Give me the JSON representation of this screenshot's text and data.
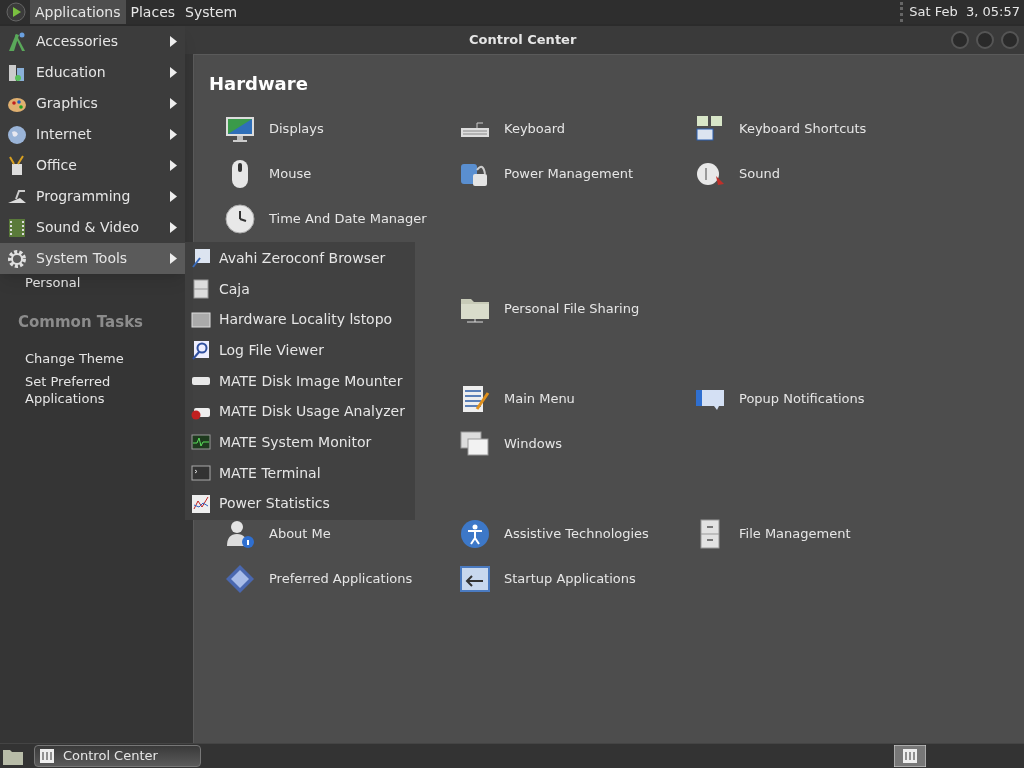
{
  "top_panel": {
    "menus": [
      {
        "label": "Applications",
        "selected": true
      },
      {
        "label": "Places",
        "selected": false
      },
      {
        "label": "System",
        "selected": false
      }
    ],
    "clock": "Sat Feb  3, 05:57"
  },
  "window": {
    "title": "Control Center",
    "sidebar": {
      "sections": [
        {
          "items": [
            "Personal"
          ]
        },
        {
          "heading": "Common Tasks",
          "items": [
            "Change Theme",
            "Set Preferred Applications"
          ]
        }
      ]
    },
    "sections": [
      {
        "heading": "Hardware",
        "rows": [
          {
            "column_1": "Displays",
            "column_2": "Keyboard",
            "column_3": "Keyboard Shortcuts"
          },
          {
            "column_1": "Mouse",
            "column_2": "Power Management",
            "column_3": "Sound"
          },
          {
            "column_1": "Time And Date Manager"
          }
        ]
      },
      {
        "rows": [
          {
            "column_2": "Personal File Sharing"
          }
        ]
      },
      {
        "rows": [
          {
            "column_2": "Main Menu",
            "column_3": "Popup Notifications"
          },
          {
            "column_2": "Windows"
          }
        ]
      },
      {
        "rows": [
          {
            "column_1": "About Me",
            "column_2": "Assistive Technologies",
            "column_3": "File Management"
          },
          {
            "column_1": "Preferred Applications",
            "column_2": "Startup Applications"
          }
        ]
      }
    ]
  },
  "applications_menu": {
    "items": [
      {
        "label": "Accessories",
        "selected": false
      },
      {
        "label": "Education",
        "selected": false
      },
      {
        "label": "Graphics",
        "selected": false
      },
      {
        "label": "Internet",
        "selected": false
      },
      {
        "label": "Office",
        "selected": false
      },
      {
        "label": "Programming",
        "selected": false
      },
      {
        "label": "Sound & Video",
        "selected": false
      },
      {
        "label": "System Tools",
        "selected": true
      }
    ],
    "submenu": [
      "Avahi Zeroconf Browser",
      "Caja",
      "Hardware Locality lstopo",
      "Log File Viewer",
      "MATE Disk Image Mounter",
      "MATE Disk Usage Analyzer",
      "MATE System Monitor",
      "MATE Terminal",
      "Power Statistics"
    ]
  },
  "taskbar": {
    "tasks": [
      {
        "label": "Control Center",
        "selected": true
      }
    ]
  }
}
